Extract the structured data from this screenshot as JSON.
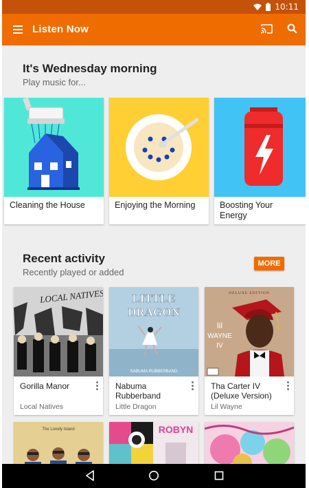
{
  "status": {
    "time": "10:11",
    "wifi_icon": "wifi-icon",
    "battery_icon": "battery-icon"
  },
  "toolbar": {
    "title": "Listen Now",
    "menu_icon": "hamburger-menu-icon",
    "cast_icon": "cast-icon",
    "search_icon": "search-icon"
  },
  "colors": {
    "accent": "#ef6c00",
    "statusbar": "#c4520a"
  },
  "mood": {
    "title": "It's Wednesday morning",
    "subtitle": "Play music for...",
    "cards": [
      {
        "label": "Cleaning the House"
      },
      {
        "label": "Enjoying the Morning"
      },
      {
        "label": "Boosting Your Energy"
      }
    ]
  },
  "recent": {
    "title": "Recent activity",
    "subtitle": "Recently played or added",
    "more_label": "MORE",
    "albums": [
      {
        "title": "Gorilla Manor",
        "artist": "Local Natives",
        "cover_text": "LOCAL NATIVES"
      },
      {
        "title": "Nabuma Rubberband",
        "artist": "Little Dragon",
        "cover_text_1": "LITTLE",
        "cover_text_2": "DRAGON",
        "cover_text_3": "NABUMA RUBBERBAND"
      },
      {
        "title": "Tha Carter IV (Deluxe Version)",
        "artist": "Lil Wayne",
        "cover_text_1": "DELUXE EDITION",
        "cover_text_2": "lil",
        "cover_text_3": "WAYNE",
        "cover_text_4": "IV"
      }
    ],
    "more_albums": [
      {
        "cover_text": "The Lonely Island"
      },
      {
        "cover_text": "ROBYN"
      },
      {
        "cover_text": ""
      }
    ]
  },
  "navbar": {
    "back_icon": "back-icon",
    "home_icon": "home-icon",
    "recents_icon": "recents-icon"
  }
}
